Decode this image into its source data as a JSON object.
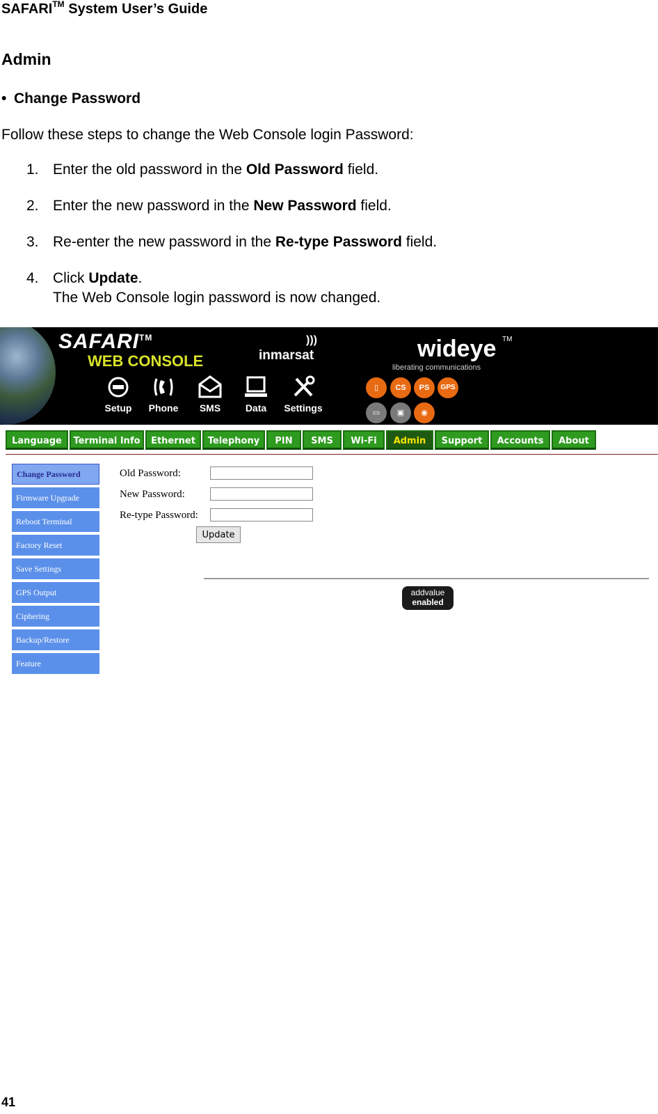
{
  "doc": {
    "header_title": "SAFARI",
    "header_tm": "TM",
    "header_rest": " System User’s Guide",
    "section": "Admin",
    "bullet": "Change Password",
    "intro": "Follow these steps to change the Web Console login Password:",
    "steps": [
      {
        "num": "1.",
        "pre": "Enter the old password in the ",
        "bold": "Old Password",
        "post": " field."
      },
      {
        "num": "2.",
        "pre": "Enter the new password in the ",
        "bold": "New Password",
        "post": " field."
      },
      {
        "num": "3.",
        "pre": "Re-enter the new password in the ",
        "bold": "Re-type Password",
        "post": " field."
      },
      {
        "num": "4.",
        "pre": "Click ",
        "bold": "Update",
        "post": ".",
        "sub": "The Web Console login password is now changed."
      }
    ],
    "page_number": "41"
  },
  "console": {
    "logo": "SAFARI",
    "logo_tm": "TM",
    "subtitle": "WEB CONSOLE",
    "inmarsat": "inmarsat",
    "wideye": "wideye",
    "wideye_tm": "TM",
    "wideye_tagline": "liberating communications",
    "top_icons": [
      {
        "label": "Setup",
        "icon": "setup-icon"
      },
      {
        "label": "Phone",
        "icon": "phone-icon"
      },
      {
        "label": "SMS",
        "icon": "sms-icon"
      },
      {
        "label": "Data",
        "icon": "data-icon"
      },
      {
        "label": "Settings",
        "icon": "settings-icon"
      }
    ],
    "status": [
      "CS",
      "PS",
      "GPS"
    ],
    "tabs": [
      "Language",
      "Terminal Info",
      "Ethernet",
      "Telephony",
      "PIN",
      "SMS",
      "Wi-Fi",
      "Admin",
      "Support",
      "Accounts",
      "About"
    ],
    "active_tab": "Admin",
    "side_menu": [
      "Change Password",
      "Firmware Upgrade",
      "Reboot Terminal",
      "Factory Reset",
      "Save Settings",
      "GPS Output",
      "Ciphering",
      "Backup/Restore",
      "Feature"
    ],
    "form": {
      "old_label": "Old Password:",
      "new_label": "New Password:",
      "retype_label": "Re-type Password:",
      "update_label": "Update"
    },
    "badge_line1": "addvalue",
    "badge_line2": "enabled"
  },
  "colors": {
    "tab_green": "#2e9a1f",
    "tab_active_text": "#f7e400",
    "side_blue": "#5b90ea",
    "banner_bg": "#000000"
  }
}
